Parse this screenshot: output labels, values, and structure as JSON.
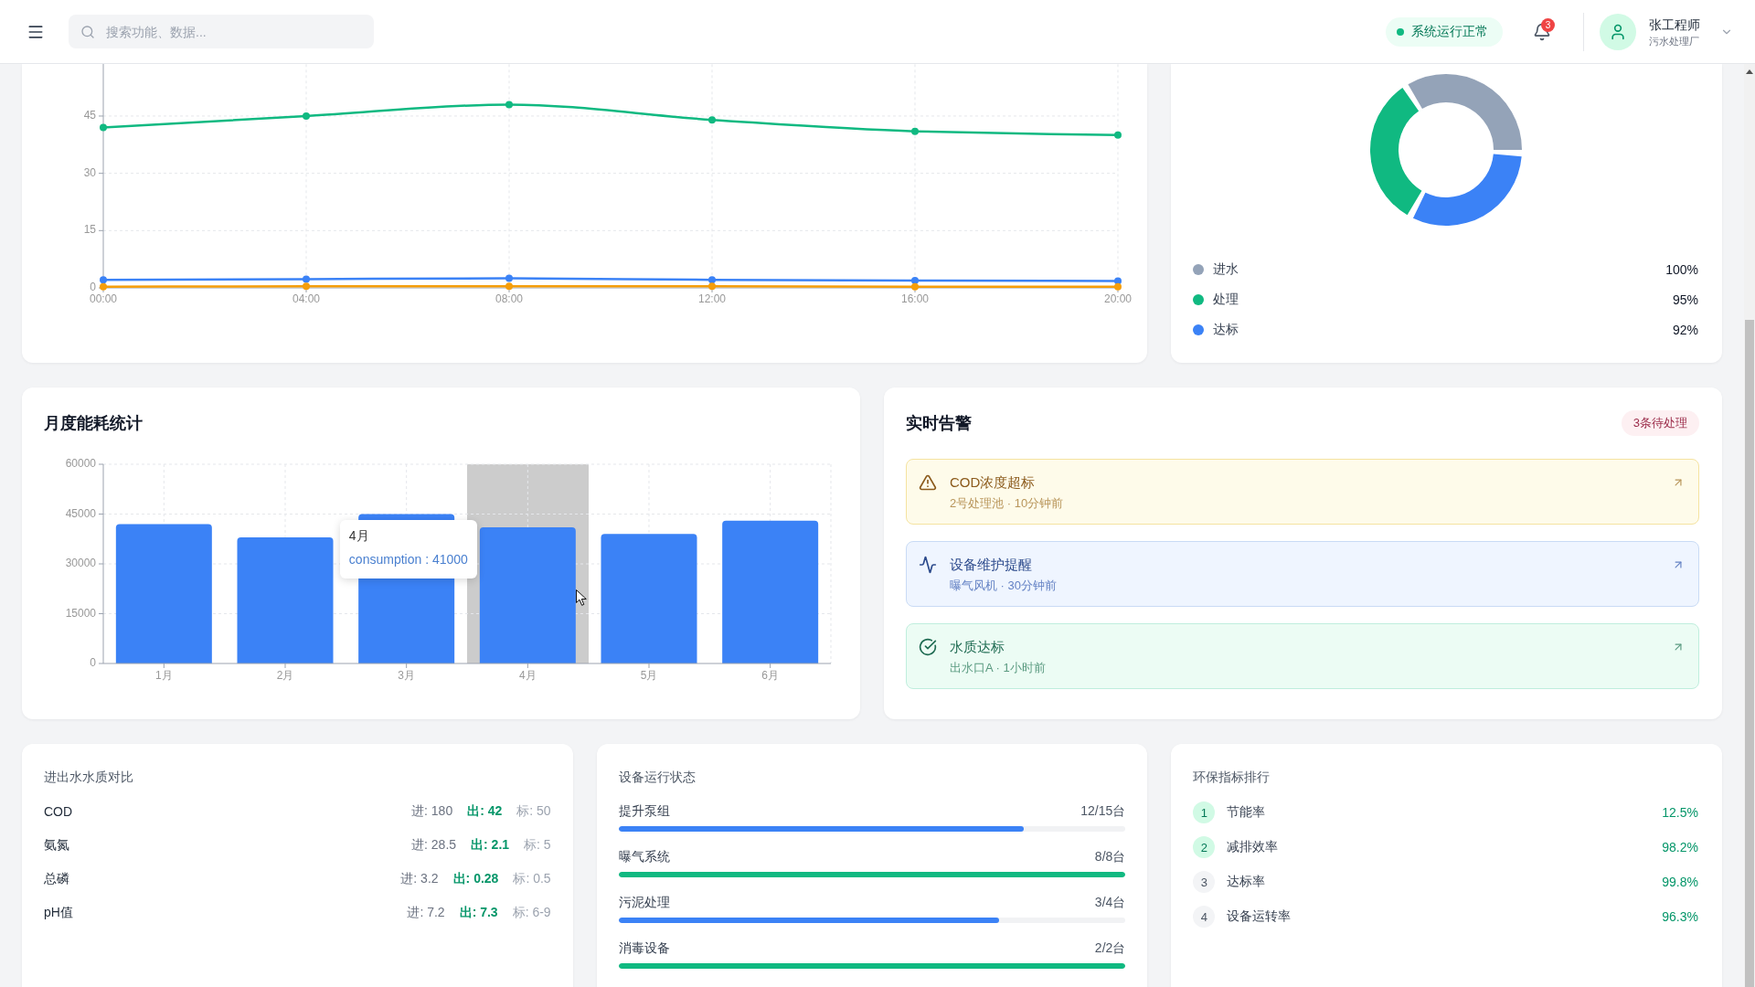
{
  "header": {
    "search": {
      "placeholder": "搜索功能、数据..."
    },
    "system_status": {
      "label": "系统运行正常"
    },
    "notifications": {
      "count": "3"
    },
    "user": {
      "name": "张工程师",
      "role": "污水处理厂"
    }
  },
  "water_quality_trend": {
    "chart_data": {
      "type": "line",
      "x": [
        "00:00",
        "04:00",
        "08:00",
        "12:00",
        "16:00",
        "20:00"
      ],
      "ylim": [
        0,
        60
      ],
      "yticks": [
        0,
        15,
        30,
        45
      ],
      "grid": true,
      "series": [
        {
          "color": "#10b981",
          "marker": "circle",
          "values": [
            42,
            45,
            48,
            44,
            41,
            40
          ]
        },
        {
          "color": "#3b82f6",
          "marker": "circle",
          "values": [
            2.1,
            2.3,
            2.5,
            2.1,
            1.9,
            1.8
          ]
        },
        {
          "color": "#f59e0b",
          "marker": "circle",
          "values": [
            0.3,
            0.4,
            0.4,
            0.4,
            0.3,
            0.3
          ]
        }
      ]
    }
  },
  "treatment_distribution": {
    "chart_data": {
      "type": "donut",
      "values": [
        34.8,
        33.1,
        32.1
      ]
    },
    "legend": [
      {
        "label": "进水",
        "value": "100%",
        "color": "#94a3b8"
      },
      {
        "label": "处理",
        "value": "95%",
        "color": "#10b981"
      },
      {
        "label": "达标",
        "value": "92%",
        "color": "#3b82f6"
      }
    ]
  },
  "monthly_energy": {
    "title": "月度能耗统计",
    "chart_data": {
      "type": "bar",
      "categories": [
        "1月",
        "2月",
        "3月",
        "4月",
        "5月",
        "6月"
      ],
      "ylim": [
        0,
        60000
      ],
      "yticks": [
        0,
        15000,
        30000,
        45000,
        60000
      ],
      "grid": true,
      "series": [
        {
          "color": "#3b82f6",
          "values": [
            42000,
            38000,
            45000,
            41000,
            39000,
            43000
          ]
        }
      ]
    },
    "hovered": [
      false,
      false,
      false,
      true,
      false,
      false
    ],
    "tooltip": {
      "title": "4月",
      "text": "consumption : 41000"
    }
  },
  "alerts": {
    "title": "实时告警",
    "badge": "3条待处理",
    "items": [
      {
        "kind": "warning",
        "title": "COD浓度超标",
        "detail": "2号处理池 · 10分钟前"
      },
      {
        "kind": "info",
        "title": "设备维护提醒",
        "detail": "曝气风机 · 30分钟前"
      },
      {
        "kind": "success",
        "title": "水质达标",
        "detail": "出水口A · 1小时前"
      }
    ]
  },
  "water_quality_compare": {
    "title": "进出水水质对比",
    "rows": [
      {
        "name": "COD",
        "inflow": "进: 180",
        "outflow": "出: 42",
        "standard": "标: 50"
      },
      {
        "name": "氨氮",
        "inflow": "进: 28.5",
        "outflow": "出: 2.1",
        "standard": "标: 5"
      },
      {
        "name": "总磷",
        "inflow": "进: 3.2",
        "outflow": "出: 0.28",
        "standard": "标: 0.5"
      },
      {
        "name": "pH值",
        "inflow": "进: 7.2",
        "outflow": "出: 7.3",
        "standard": "标: 6-9"
      }
    ]
  },
  "equipment_status": {
    "title": "设备运行状态",
    "items": [
      {
        "name": "提升泵组",
        "count": "12/15台",
        "level": 0.8,
        "color": "#3b82f6"
      },
      {
        "name": "曝气系统",
        "count": "8/8台",
        "level": 1,
        "color": "#10b981"
      },
      {
        "name": "污泥处理",
        "count": "3/4台",
        "level": 0.75,
        "color": "#3b82f6"
      },
      {
        "name": "消毒设备",
        "count": "2/2台",
        "level": 1,
        "color": "#10b981"
      }
    ]
  },
  "ranking": {
    "title": "环保指标排行",
    "items": [
      {
        "rank": "1",
        "name": "节能率",
        "value": "12.5%",
        "highlighted": true
      },
      {
        "rank": "2",
        "name": "减排效率",
        "value": "98.2%",
        "highlighted": true
      },
      {
        "rank": "3",
        "name": "达标率",
        "value": "99.8%",
        "highlighted": false
      },
      {
        "rank": "4",
        "name": "设备运转率",
        "value": "96.3%",
        "highlighted": false
      }
    ]
  }
}
